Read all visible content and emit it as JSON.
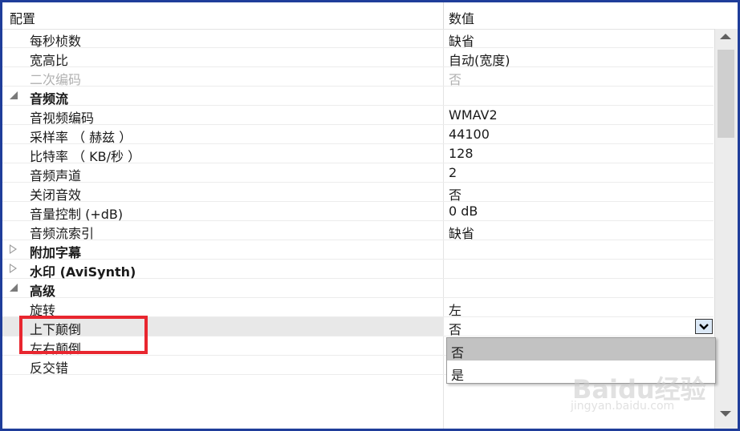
{
  "header": {
    "name_col": "配置",
    "value_col": "数值"
  },
  "rows": [
    {
      "name": "每秒桢数",
      "value": "缺省",
      "type": "item"
    },
    {
      "name": "宽高比",
      "value": "自动(宽度)",
      "type": "item"
    },
    {
      "name": "二次编码",
      "value": "否",
      "type": "disabled"
    },
    {
      "name": "音频流",
      "value": "",
      "type": "category",
      "expanded": true
    },
    {
      "name": "音视频编码",
      "value": "WMAV2",
      "type": "item"
    },
    {
      "name": "采样率 （ 赫兹 ）",
      "value": "44100",
      "type": "item"
    },
    {
      "name": "比特率 （ KB/秒 ）",
      "value": "128",
      "type": "item"
    },
    {
      "name": "音频声道",
      "value": "2",
      "type": "item"
    },
    {
      "name": "关闭音效",
      "value": "否",
      "type": "item"
    },
    {
      "name": "音量控制 (+dB)",
      "value": "0 dB",
      "type": "item"
    },
    {
      "name": "音频流索引",
      "value": "缺省",
      "type": "item"
    },
    {
      "name": "附加字幕",
      "value": "",
      "type": "category",
      "expanded": false
    },
    {
      "name": "水印 (AviSynth)",
      "value": "",
      "type": "category",
      "expanded": false
    },
    {
      "name": "高级",
      "value": "",
      "type": "category",
      "expanded": true
    },
    {
      "name": "旋转",
      "value": "左",
      "type": "item"
    },
    {
      "name": "上下颠倒",
      "value": "否",
      "type": "selected"
    },
    {
      "name": "左右颠倒",
      "value": "",
      "type": "item"
    },
    {
      "name": "反交错",
      "value": "",
      "type": "item"
    }
  ],
  "dropdown": {
    "options": [
      "否",
      "是"
    ],
    "highlighted": "否"
  },
  "watermark": {
    "brand": "Baidu经验",
    "url": "jingyan.baidu.com"
  },
  "colors": {
    "frame": "#1f3d9a",
    "highlight_box": "#e8262f",
    "combo_button": "#dbe8f6",
    "selected_option": "#c2c2c2"
  }
}
